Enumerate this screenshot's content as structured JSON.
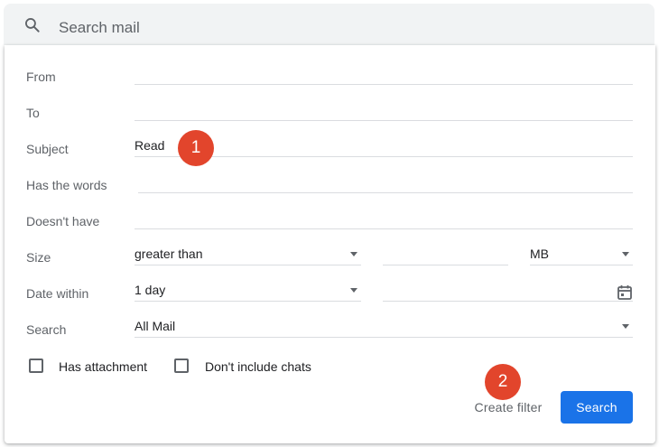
{
  "search": {
    "placeholder": "Search mail",
    "icon": "search-icon"
  },
  "form": {
    "from": {
      "label": "From",
      "value": ""
    },
    "to": {
      "label": "To",
      "value": ""
    },
    "subject": {
      "label": "Subject",
      "value": "Read"
    },
    "has_words": {
      "label": "Has the words",
      "value": ""
    },
    "doesnt_have": {
      "label": "Doesn't have",
      "value": ""
    },
    "size": {
      "label": "Size",
      "operator": "greater than",
      "amount": "",
      "unit": "MB"
    },
    "date_within": {
      "label": "Date within",
      "range": "1 day",
      "date": ""
    },
    "search_in": {
      "label": "Search",
      "value": "All Mail"
    },
    "has_attachment": {
      "label": "Has attachment",
      "checked": false
    },
    "no_chats": {
      "label": "Don't include chats",
      "checked": false
    }
  },
  "actions": {
    "create_filter": "Create filter",
    "search": "Search"
  },
  "annotations": {
    "step1": "1",
    "step2": "2"
  },
  "colors": {
    "accent": "#1a73e8",
    "badge": "#e2452c",
    "searchbar_bg": "#f1f3f4"
  }
}
